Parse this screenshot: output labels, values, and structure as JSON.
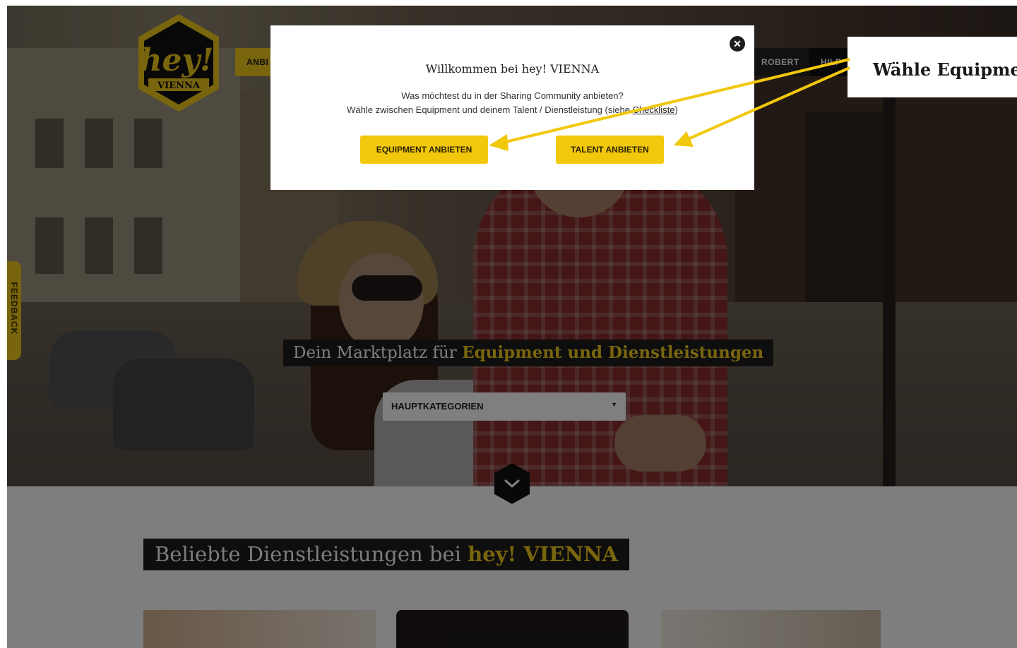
{
  "header": {
    "logo_text": "hey!",
    "logo_sub": "VIENNA",
    "nav_offer_label": "ANBI",
    "nav_user_label": "ROBERT",
    "nav_help_label": "HILF"
  },
  "feedback_tab": {
    "label": "FEEDBACK"
  },
  "hero": {
    "tagline_prefix": "Dein Marktplatz für",
    "tagline_highlight": "Equipment und Dienstleistungen",
    "category_select": {
      "selected": "HAUPTKATEGORIEN"
    }
  },
  "section_popular": {
    "title_prefix": "Beliebte Dienstleistungen bei",
    "title_highlight": "hey! VIENNA"
  },
  "modal": {
    "title": "Willkommen bei hey! VIENNA",
    "line1": "Was möchtest du in der Sharing Community anbieten?",
    "line2_text": "Wähle zwischen Equipment und deinem Talent / Dienstleistung (siehe",
    "line2_link": "Checkliste",
    "line2_end": ")",
    "btn_equipment": "EQUIPMENT ANBIETEN",
    "btn_talent": "TALENT ANBIETEN",
    "close_icon": "close-icon"
  },
  "callout": {
    "text": "Wähle Equipment"
  },
  "colors": {
    "accent": "#f2c80c",
    "dark": "#1c1c1c",
    "arrow": "#f2c80c"
  }
}
